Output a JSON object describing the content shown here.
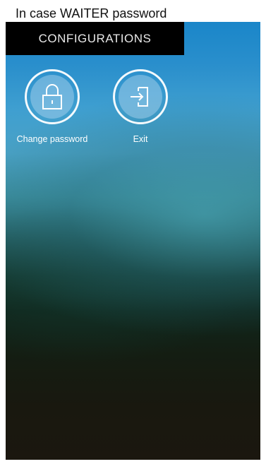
{
  "caption": "In case WAITER password",
  "header": {
    "title": "CONFIGURATIONS"
  },
  "actions": [
    {
      "label": "Change password",
      "icon": "lock-icon"
    },
    {
      "label": "Exit",
      "icon": "exit-icon"
    }
  ]
}
